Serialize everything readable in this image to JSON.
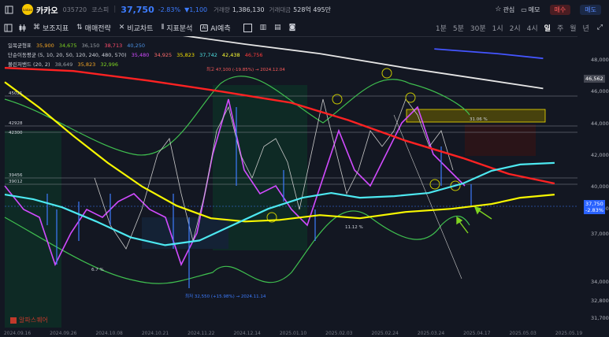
{
  "header": {
    "logo_text": "kakao",
    "name": "카카오",
    "code": "035720",
    "market": "코스피",
    "price": "37,750",
    "change_pct": "-2.83%",
    "change_abs": "▼1,100",
    "volume_label": "거래량",
    "volume": "1,386,130",
    "amount_label": "거래대금",
    "amount": "528억 495만",
    "favorite": "관심",
    "memo": "메모",
    "buy": "매수",
    "sell": "매도"
  },
  "toolbar": {
    "sub_indicator": "보조지표",
    "strategy": "매매전략",
    "compare": "비교차트",
    "analysis": "지표분석",
    "ai": "AI예측",
    "timeframes": [
      "1분",
      "5분",
      "30분",
      "1시",
      "2시",
      "4시",
      "일",
      "주",
      "월",
      "년"
    ],
    "active_timeframe": "일"
  },
  "legend": {
    "ichimoku_label": "일목균형표",
    "ichimoku_values": [
      "35,900",
      "34,675",
      "36,150",
      "38,713",
      "40,250"
    ],
    "ma_label": "단순이동평균 (5, 10, 20, 50, 120, 240, 480, 570)",
    "ma_values": [
      "35,480",
      "34,925",
      "35,823",
      "37,742",
      "42,438",
      "46,756"
    ],
    "bb_label": "볼린저밴드 (20, 2)",
    "bb_values": [
      "38,649",
      "35,823",
      "32,996"
    ],
    "colors": {
      "ichimoku": [
        "#f5a623",
        "#7ed321",
        "#9aa0a6",
        "#ff4d6d",
        "#4a90e2"
      ],
      "ma": [
        "#d14bff",
        "#ff6b6b",
        "#f5e000",
        "#50e3e3",
        "#ffff33",
        "#ff3b3b"
      ],
      "bb": [
        "#9aa0a6",
        "#f5a623",
        "#7ed321"
      ]
    }
  },
  "annotations": {
    "high": "최고 47,100 (-19.85%) → 2024.12.04",
    "low": "최저 32,550 (+15.98%) → 2024.11.14",
    "pct_31": "31.06 %",
    "pct_112": "11.12 %",
    "pct_67": "6.7 %",
    "level_45021": "45021",
    "level_42928": "42928",
    "level_42300": "42300",
    "level_39456": "39456",
    "level_39012": "39012",
    "watermark": "알파스퀘어"
  },
  "price_labels": {
    "current": "37,750",
    "current_pct": "-2.83%",
    "mark": "46,562"
  },
  "chart_data": {
    "type": "line",
    "title": "",
    "y_ticks": [
      48000,
      46000,
      44000,
      42000,
      40000,
      38600,
      37000,
      34000,
      32800,
      31700
    ],
    "y_tick_labels": [
      "48,000",
      "46,000",
      "44,000",
      "42,000",
      "40,000",
      "38,600",
      "37,000",
      "34,000",
      "32,800",
      "31,700"
    ],
    "x_tick_labels": [
      "2024.09.16",
      "2024.09.26",
      "2024.10.08",
      "2024.10.21",
      "2024.11.22",
      "2024.12.14",
      "2025.01.10",
      "2025.02.03",
      "2025.02.24",
      "2025.03.24",
      "2025.04.17",
      "2025.05.03",
      "2025.05.19"
    ],
    "ylim": [
      31000,
      49500
    ],
    "grid": true,
    "series": [
      {
        "name": "",
        "color": "#ff2222",
        "width": 2.4,
        "x": [
          0,
          0.12,
          0.25,
          0.38,
          0.5,
          0.6,
          0.7,
          0.8,
          0.88,
          0.96
        ],
        "values": [
          47500,
          47300,
          46700,
          46000,
          45300,
          44200,
          42900,
          41800,
          40800,
          40200
        ]
      },
      {
        "name": "",
        "color": "#f7f700",
        "width": 2.2,
        "x": [
          0,
          0.06,
          0.12,
          0.18,
          0.24,
          0.3,
          0.36,
          0.42,
          0.48,
          0.55,
          0.62,
          0.7,
          0.78,
          0.85,
          0.9,
          0.96
        ],
        "values": [
          46600,
          45000,
          43200,
          41500,
          40000,
          38800,
          38000,
          37800,
          37900,
          38200,
          38000,
          38400,
          38600,
          38900,
          39300,
          39500
        ]
      },
      {
        "name": "",
        "color": "#4de8f0",
        "width": 2.2,
        "x": [
          0,
          0.05,
          0.1,
          0.16,
          0.22,
          0.28,
          0.34,
          0.4,
          0.46,
          0.52,
          0.57,
          0.62,
          0.68,
          0.74,
          0.8,
          0.85,
          0.9,
          0.96
        ],
        "values": [
          39500,
          39200,
          38700,
          37800,
          36800,
          36300,
          36600,
          37600,
          38600,
          39300,
          39600,
          39300,
          39400,
          39600,
          40200,
          41000,
          41400,
          41500
        ]
      },
      {
        "name": "",
        "color": "#e6e6e6",
        "width": 1.8,
        "x": [
          0.18,
          0.3,
          0.42,
          0.55,
          0.7,
          0.83,
          0.94
        ],
        "values": [
          49800,
          49600,
          49000,
          48400,
          47500,
          46800,
          46200
        ]
      },
      {
        "name": "",
        "color": "#4455ff",
        "width": 1.8,
        "x": [
          0.75,
          0.86,
          0.94
        ],
        "values": [
          48700,
          48400,
          48100
        ]
      }
    ]
  }
}
